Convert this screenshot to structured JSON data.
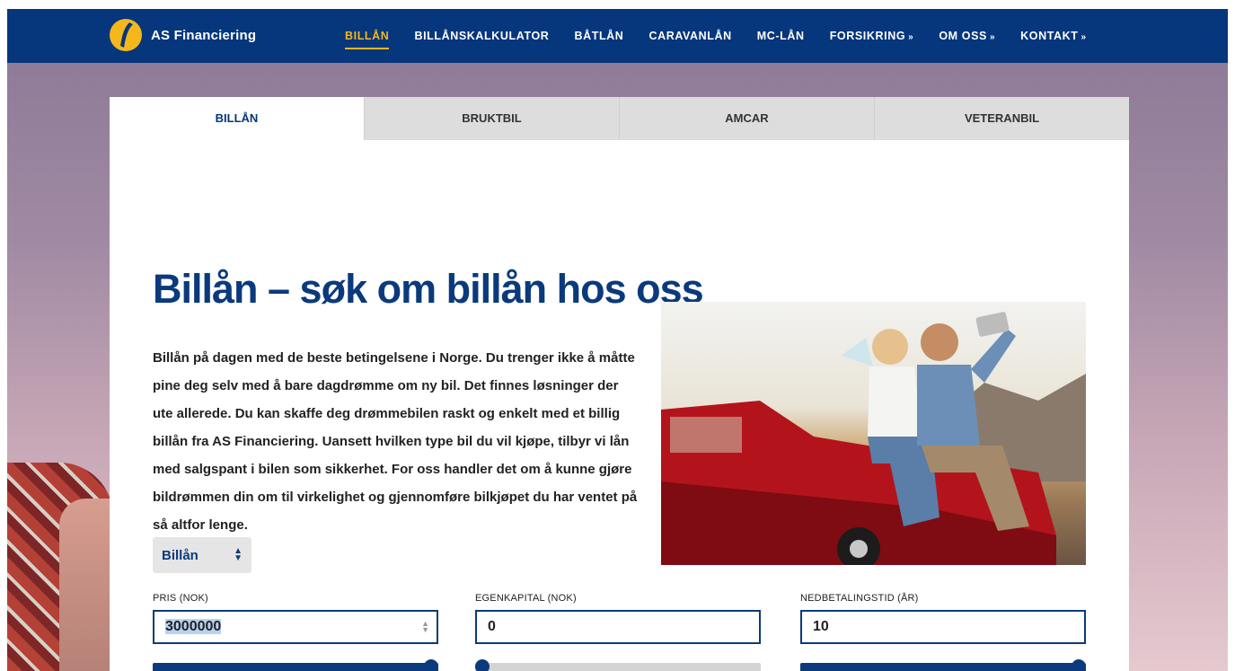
{
  "brand": {
    "name": "AS Financiering"
  },
  "nav": {
    "items": [
      {
        "label": "BILLÅN",
        "active": true
      },
      {
        "label": "BILLÅNSKALKULATOR"
      },
      {
        "label": "BÅTLÅN"
      },
      {
        "label": "CARAVANLÅN"
      },
      {
        "label": "MC-LÅN"
      },
      {
        "label": "FORSIKRING",
        "dropdown": true
      },
      {
        "label": "OM OSS",
        "dropdown": true
      },
      {
        "label": "KONTAKT",
        "dropdown": true
      }
    ],
    "dropdown_glyph": "»"
  },
  "tabs": [
    {
      "label": "BILLÅN",
      "active": true
    },
    {
      "label": "BRUKTBIL"
    },
    {
      "label": "AMCAR"
    },
    {
      "label": "VETERANBIL"
    }
  ],
  "main": {
    "headline": "Billån – søk om billån hos oss",
    "intro": "Billån på dagen med de beste betingelsene i Norge. Du trenger ikke å måtte pine deg selv med å bare dagdrømme om ny bil. Det finnes løsninger der ute allerede. Du kan skaffe deg drømmebilen raskt og enkelt med et billig billån fra AS Financiering. Uansett hvilken type bil du vil kjøpe, tilbyr vi lån med salgspant i bilen som sikkerhet. For oss handler det om å kunne gjøre bildrømmen din om til virkelighet og gjennomføre bilkjøpet du har ventet på så altfor lenge."
  },
  "calculator": {
    "loan_type": {
      "selected": "Billån"
    },
    "fields": [
      {
        "label": "PRIS (NOK)",
        "value": "3000000",
        "slider_fraction": 1.0
      },
      {
        "label": "EGENKAPITAL (NOK)",
        "value": "0",
        "slider_fraction": 0.0
      },
      {
        "label": "NEDBETALINGSTID (ÅR)",
        "value": "10",
        "slider_fraction": 1.0
      }
    ]
  },
  "colors": {
    "brand_navy": "#06367b",
    "accent_yellow": "#f5b81c"
  }
}
